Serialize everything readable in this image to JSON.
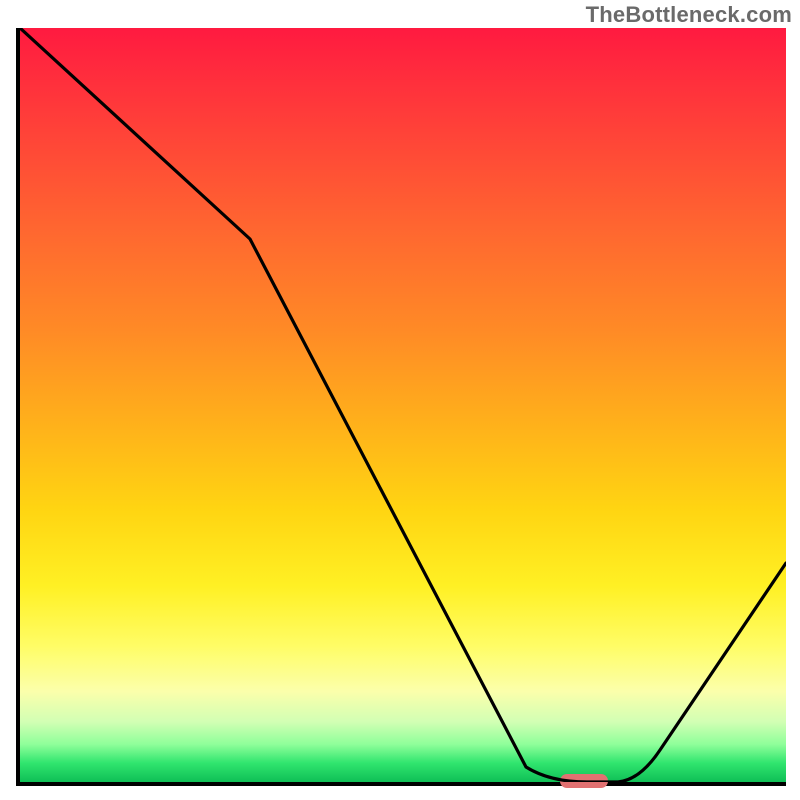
{
  "watermark": "TheBottleneck.com",
  "colors": {
    "gradient_top": "#ff1a40",
    "gradient_mid_orange": "#ff8a26",
    "gradient_mid_yellow": "#ffd512",
    "gradient_pale": "#fbffab",
    "gradient_green": "#0fbf56",
    "curve": "#000000",
    "axis": "#000000",
    "marker": "#e17171"
  },
  "chart_data": {
    "type": "line",
    "title": "",
    "xlabel": "",
    "ylabel": "",
    "xlim": [
      0,
      100
    ],
    "ylim": [
      0,
      100
    ],
    "x": [
      0,
      30,
      66,
      74,
      78,
      100
    ],
    "values": [
      100,
      72,
      2,
      0,
      0,
      29
    ],
    "marker": {
      "x_start": 70,
      "x_end": 78,
      "y": 0
    },
    "notes": "V-shaped bottleneck curve over a vertical red→green heatmap gradient; minimum (optimal) around x≈74–78."
  }
}
